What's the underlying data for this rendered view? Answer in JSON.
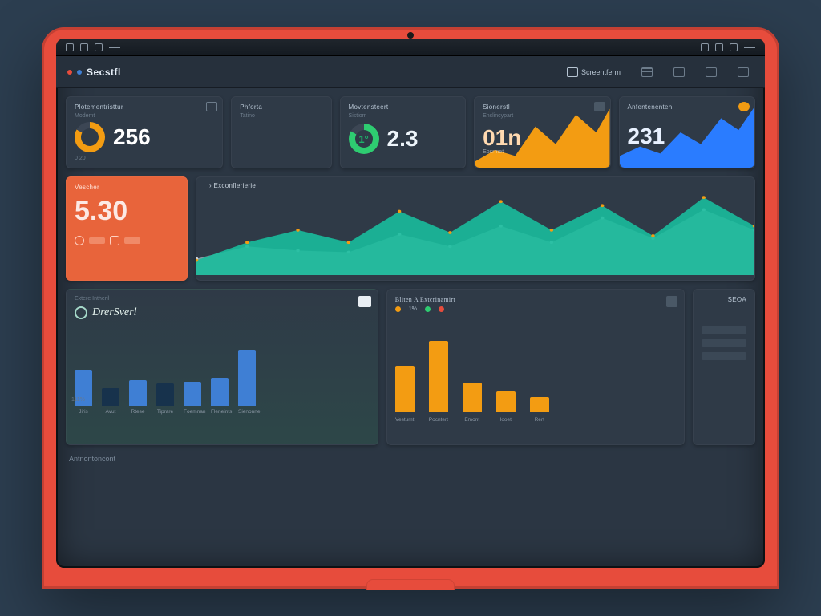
{
  "brand": "Secstfl",
  "nav": {
    "primary": "Screentferm",
    "icons": [
      "menu-icon",
      "grid-icon",
      "grid2-icon",
      "window-icon"
    ]
  },
  "row1": {
    "cardA": {
      "title": "Plotementristtur",
      "sub": "Modemt",
      "value": "256",
      "footnote": "0 20"
    },
    "cardB": {
      "title": "Phforta",
      "sub": "Tatino"
    },
    "cardC": {
      "title": "Movtensteert",
      "sub": "Sistiom",
      "value": "2.3",
      "gauge_label": "1°"
    },
    "cardD": {
      "title": "Sionerstl",
      "sub": "Enclincypart",
      "value": "01n",
      "chip": "Eosrmet"
    },
    "cardE": {
      "title": "Anfentenenten",
      "sub": "",
      "value": "231"
    }
  },
  "row2": {
    "tile": {
      "title": "Vescher",
      "value": "5.30"
    },
    "chart": {
      "title": "Exconflerierie"
    }
  },
  "row3": {
    "left": {
      "title": "Extere Intheril",
      "brand": "DrerSverl",
      "axis": "111%"
    },
    "right": {
      "title": "Bliten A Extcrinamirt",
      "legend": [
        "1%"
      ]
    },
    "side": {
      "title": "SEOA"
    }
  },
  "footer": "Antnontoncont",
  "colors": {
    "orange": "#f39c12",
    "orange2": "#e8643b",
    "green": "#1db36a",
    "teal": "#1abc9c",
    "blue": "#3f7fd4",
    "blue2": "#2a7cff",
    "slate": "#9aa7b4",
    "card": "#2f3a47"
  },
  "chart_data": [
    {
      "type": "area",
      "title": "Exconflerierie",
      "x": [
        0,
        1,
        2,
        3,
        4,
        5,
        6,
        7,
        8,
        9,
        10,
        11
      ],
      "series": [
        {
          "name": "teal",
          "color": "#1abc9c",
          "values": [
            18,
            40,
            55,
            40,
            78,
            52,
            90,
            55,
            85,
            48,
            95,
            60
          ]
        },
        {
          "name": "slate",
          "color": "#9aa7b4",
          "values": [
            20,
            35,
            30,
            28,
            50,
            35,
            60,
            40,
            70,
            45,
            80,
            55
          ]
        }
      ],
      "ylim": [
        0,
        100
      ]
    },
    {
      "type": "bar",
      "title": "DrerSverl",
      "categories": [
        "Jiris",
        "Avut",
        "Rtese",
        "Tiprare",
        "Foemnan",
        "Fleneints",
        "Sienonne"
      ],
      "values": [
        45,
        22,
        32,
        28,
        30,
        35,
        70
      ],
      "colors": [
        "#3f7fd4",
        "#17324c",
        "#3f7fd4",
        "#17324c",
        "#3f7fd4",
        "#3f7fd4",
        "#3f7fd4"
      ],
      "ylim": [
        0,
        100
      ]
    },
    {
      "type": "bar",
      "title": "Bliten A Extcrinamirt",
      "categories": [
        "Vestumt",
        "Pocntert",
        "Emont",
        "Iooet",
        "Rert"
      ],
      "values": [
        55,
        85,
        35,
        25,
        18
      ],
      "color": "#f39c12",
      "ylim": [
        0,
        100
      ]
    }
  ]
}
